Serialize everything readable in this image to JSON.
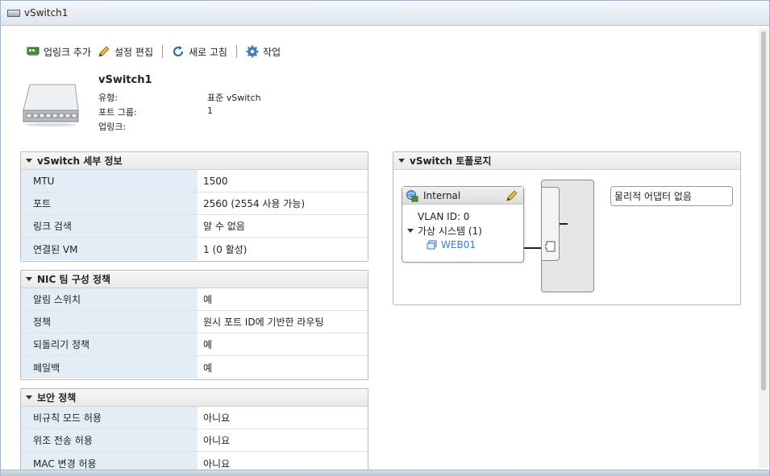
{
  "window": {
    "title": "vSwitch1"
  },
  "toolbar": {
    "add_uplink": "업링크 추가",
    "edit_settings": "설정 편집",
    "refresh": "새로 고침",
    "actions": "작업"
  },
  "header": {
    "name": "vSwitch1",
    "rows": [
      {
        "label": "유형:",
        "value": "표준 vSwitch"
      },
      {
        "label": "포트 그룹:",
        "value": "1"
      },
      {
        "label": "업링크:",
        "value": ""
      }
    ]
  },
  "details": {
    "title": "vSwitch 세부 정보",
    "rows": [
      {
        "key": "MTU",
        "value": "1500"
      },
      {
        "key": "포트",
        "value": "2560 (2554 사용 가능)"
      },
      {
        "key": "링크 검색",
        "value": "알 수 없음"
      },
      {
        "key": "연결된 VM",
        "value": "1 (0 활성)"
      }
    ]
  },
  "nic_teaming": {
    "title": "NIC 팀 구성 정책",
    "rows": [
      {
        "key": "알림 스위치",
        "value": "예"
      },
      {
        "key": "정책",
        "value": "원시 포트 ID에 기반한 라우팅"
      },
      {
        "key": "되돌리기 정책",
        "value": "예"
      },
      {
        "key": "페일백",
        "value": "예"
      }
    ]
  },
  "security": {
    "title": "보안 정책",
    "rows": [
      {
        "key": "비규칙 모드 허용",
        "value": "아니요"
      },
      {
        "key": "위조 전송 허용",
        "value": "아니요"
      },
      {
        "key": "MAC 변경 허용",
        "value": "아니요"
      }
    ]
  },
  "topology": {
    "title": "vSwitch 토폴로지",
    "portgroup": {
      "name": "Internal",
      "vlan": "VLAN ID: 0",
      "vm_group": "가상 시스템 (1)",
      "vm": "WEB01"
    },
    "no_adapters": "물리적 어댑터 없음"
  },
  "colors": {
    "key_cell_bg": "#e3edf6",
    "link_blue": "#3a7cc4",
    "accent": "#2b6cb0"
  }
}
